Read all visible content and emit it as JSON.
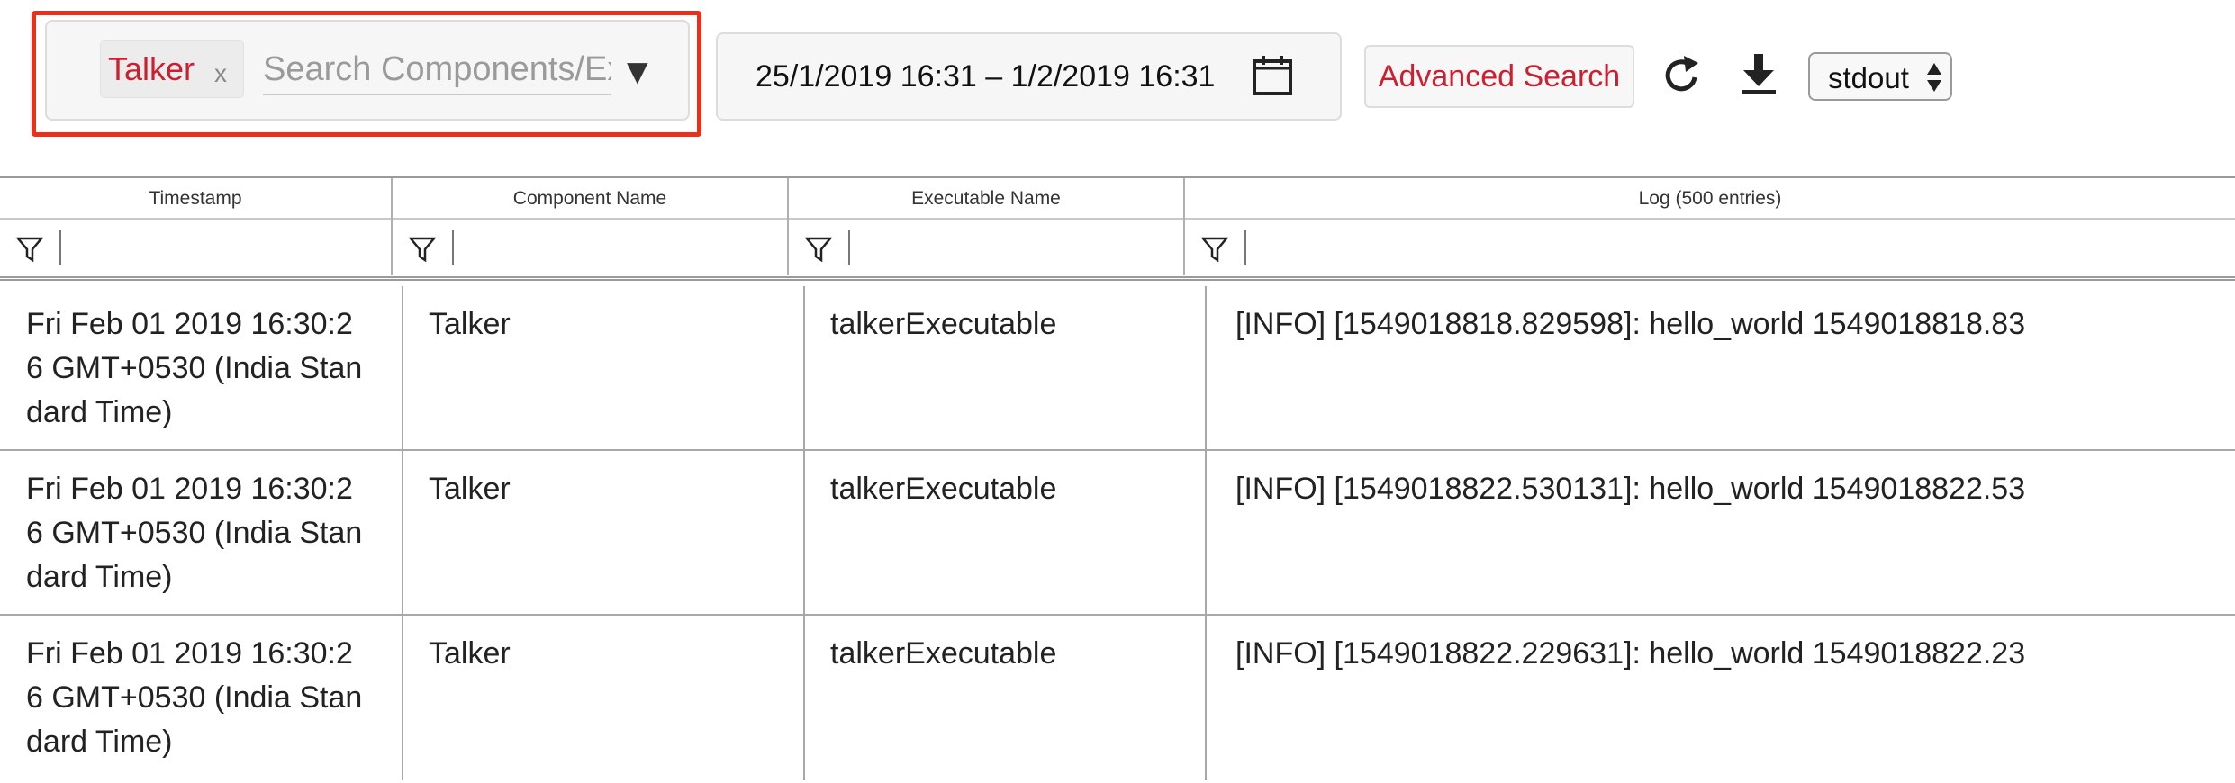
{
  "toolbar": {
    "search": {
      "chip_label": "Talker",
      "chip_remove": "x",
      "placeholder": "Search Components/Executables",
      "caret": "▼"
    },
    "date_range": "25/1/2019  16:31 – 1/2/2019  16:31",
    "advanced_search_label": "Advanced Search",
    "stream_select_value": "stdout",
    "icons": [
      "calendar-icon",
      "refresh-icon",
      "download-icon",
      "filter-icon"
    ],
    "accent_color": "#cc1f30",
    "highlight_color": "#e8301c"
  },
  "table": {
    "columns": [
      "Timestamp",
      "Component Name",
      "Executable Name",
      "Log (500 entries)"
    ],
    "rows": [
      {
        "timestamp": "Fri Feb 01 2019 16:30:26 GMT+0530 (India Standard Time)",
        "component": "Talker",
        "executable": "talkerExecutable",
        "log": "[INFO] [1549018818.829598]: hello_world 1549018818.83"
      },
      {
        "timestamp": "Fri Feb 01 2019 16:30:26 GMT+0530 (India Standard Time)",
        "component": "Talker",
        "executable": "talkerExecutable",
        "log": "[INFO] [1549018822.530131]: hello_world 1549018822.53"
      },
      {
        "timestamp": "Fri Feb 01 2019 16:30:26 GMT+0530 (India Standard Time)",
        "component": "Talker",
        "executable": "talkerExecutable",
        "log": "[INFO] [1549018822.229631]: hello_world 1549018822.23"
      }
    ]
  }
}
